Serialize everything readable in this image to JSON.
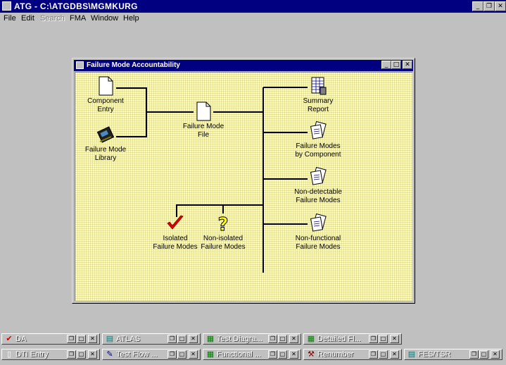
{
  "app": {
    "title": "ATG - C:\\ATGDBS\\MGMKURG",
    "controls": {
      "minimize": "_",
      "restore": "❐",
      "close": "✕"
    }
  },
  "menu": {
    "items": [
      {
        "label": "File",
        "enabled": true
      },
      {
        "label": "Edit",
        "enabled": true
      },
      {
        "label": "Search",
        "enabled": false
      },
      {
        "label": "FMA",
        "enabled": true
      },
      {
        "label": "Window",
        "enabled": true
      },
      {
        "label": "Help",
        "enabled": true
      }
    ]
  },
  "child_window": {
    "title": "Failure Mode Accountability",
    "controls": {
      "minimize": "_",
      "maximize": "□",
      "close": "✕"
    },
    "diagram": {
      "line_color": "#000000",
      "nodes": [
        {
          "id": "component-entry",
          "label": "Component\nEntry",
          "icon": "document-icon"
        },
        {
          "id": "failure-mode-library",
          "label": "Failure Mode\nLibrary",
          "icon": "library-icon"
        },
        {
          "id": "failure-mode-file",
          "label": "Failure Mode\nFile",
          "icon": "document-icon"
        },
        {
          "id": "summary-report",
          "label": "Summary\nReport",
          "icon": "spreadsheet-icon"
        },
        {
          "id": "failure-modes-by-component",
          "label": "Failure Modes\nby Component",
          "icon": "report-stack-icon"
        },
        {
          "id": "non-detectable-failure-modes",
          "label": "Non-detectable\nFailure Modes",
          "icon": "report-stack-icon"
        },
        {
          "id": "isolated-failure-modes",
          "label": "Isolated\nFailure Modes",
          "icon": "red-checkmark-icon"
        },
        {
          "id": "non-isolated-failure-modes",
          "label": "Non-isolated\nFailure Modes",
          "icon": "question-mark-icon"
        },
        {
          "id": "non-functional-failure-modes",
          "label": "Non-functional\nFailure Modes",
          "icon": "report-stack-icon"
        }
      ]
    }
  },
  "taskbar": {
    "row1": [
      {
        "label": "DA",
        "icon": "✔",
        "icon_color": "#cc0000"
      },
      {
        "label": "ATLAS",
        "icon": "▤",
        "icon_color": "#008080"
      },
      {
        "label": "Test Diagra...",
        "icon": "▦",
        "icon_color": "#008000"
      },
      {
        "label": "Detailed Fl...",
        "icon": "▦",
        "icon_color": "#008000"
      }
    ],
    "row2": [
      {
        "label": "DTI Entry",
        "icon": "▯",
        "icon_color": "#ffffff"
      },
      {
        "label": "Test Flow ...",
        "icon": "✎",
        "icon_color": "#000080"
      },
      {
        "label": "Functional ...",
        "icon": "▦",
        "icon_color": "#008000"
      },
      {
        "label": "Renumber",
        "icon": "⚒",
        "icon_color": "#800000"
      },
      {
        "label": "FES/TSR",
        "icon": "▤",
        "icon_color": "#008080"
      }
    ],
    "button_glyphs": {
      "restore": "❐",
      "maximize": "□",
      "close": "✕"
    }
  }
}
